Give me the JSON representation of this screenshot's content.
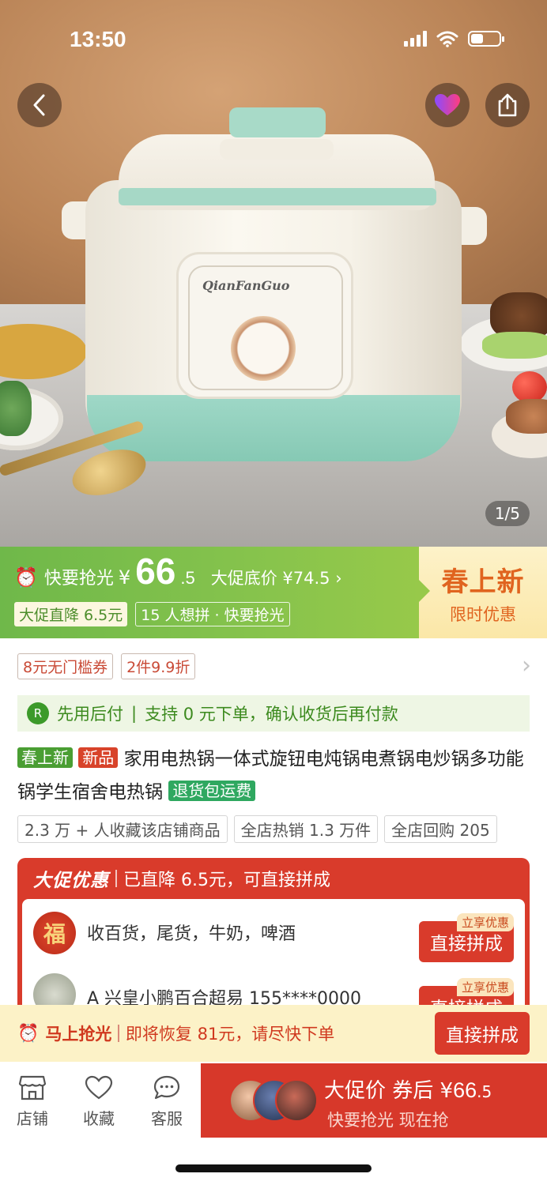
{
  "status_bar": {
    "time": "13:50"
  },
  "gallery": {
    "counter": "1/5",
    "brand_text": "QianFanGuo"
  },
  "price_banner": {
    "hurry_label": "快要抢光",
    "currency": "¥",
    "price_int": "66",
    "price_dec": ".5",
    "pre_price": "大促底价 ¥74.5",
    "tag_discount": "大促直降 6.5元",
    "tag_group": "15 人想拼 · 快要抢光",
    "promo_title": "春上新",
    "promo_sub": "限时优惠"
  },
  "coupons": [
    "8元无门槛券",
    "2件9.9折"
  ],
  "paylater": {
    "icon_text": "R",
    "title": "先用后付",
    "desc": "支持 0 元下单，确认收货后再付款"
  },
  "product": {
    "badge_spring": "春上新",
    "badge_new": "新品",
    "title": "家用电热锅一体式旋钮电炖锅电煮锅电炒锅多功能锅学生宿舍电热锅",
    "badge_return": "退货包运费"
  },
  "stats": [
    "2.3 万 + 人收藏该店铺商品",
    "全店热销 1.3 万件",
    "全店回购 205"
  ],
  "promo_card": {
    "title": "大促优惠",
    "subtitle": "已直降 6.5元，可直接拼成",
    "items": [
      {
        "avatar_text": "福",
        "name": "收百货，尾货，牛奶，啤酒",
        "tag": "立享优惠",
        "button": "直接拼成"
      },
      {
        "avatar_text": "",
        "name": "A 兴皇小鹏百合超易 155****0000",
        "tag": "立享优惠",
        "button": "直接拼成"
      }
    ]
  },
  "countdown": {
    "label": "马上抢光",
    "desc": "即将恢复 81元，请尽快下单",
    "button": "直接拼成"
  },
  "bottom_nav": {
    "store": "店铺",
    "favorite": "收藏",
    "service": "客服",
    "buy_label": "大促价 券后",
    "buy_currency": "¥",
    "buy_price_int": "66",
    "buy_price_dec": ".5",
    "buy_sub": "快要抢光 现在抢"
  },
  "colors": {
    "accent_red": "#d93b2b",
    "accent_green": "#6fb84a",
    "promo_orange": "#e0641f"
  }
}
